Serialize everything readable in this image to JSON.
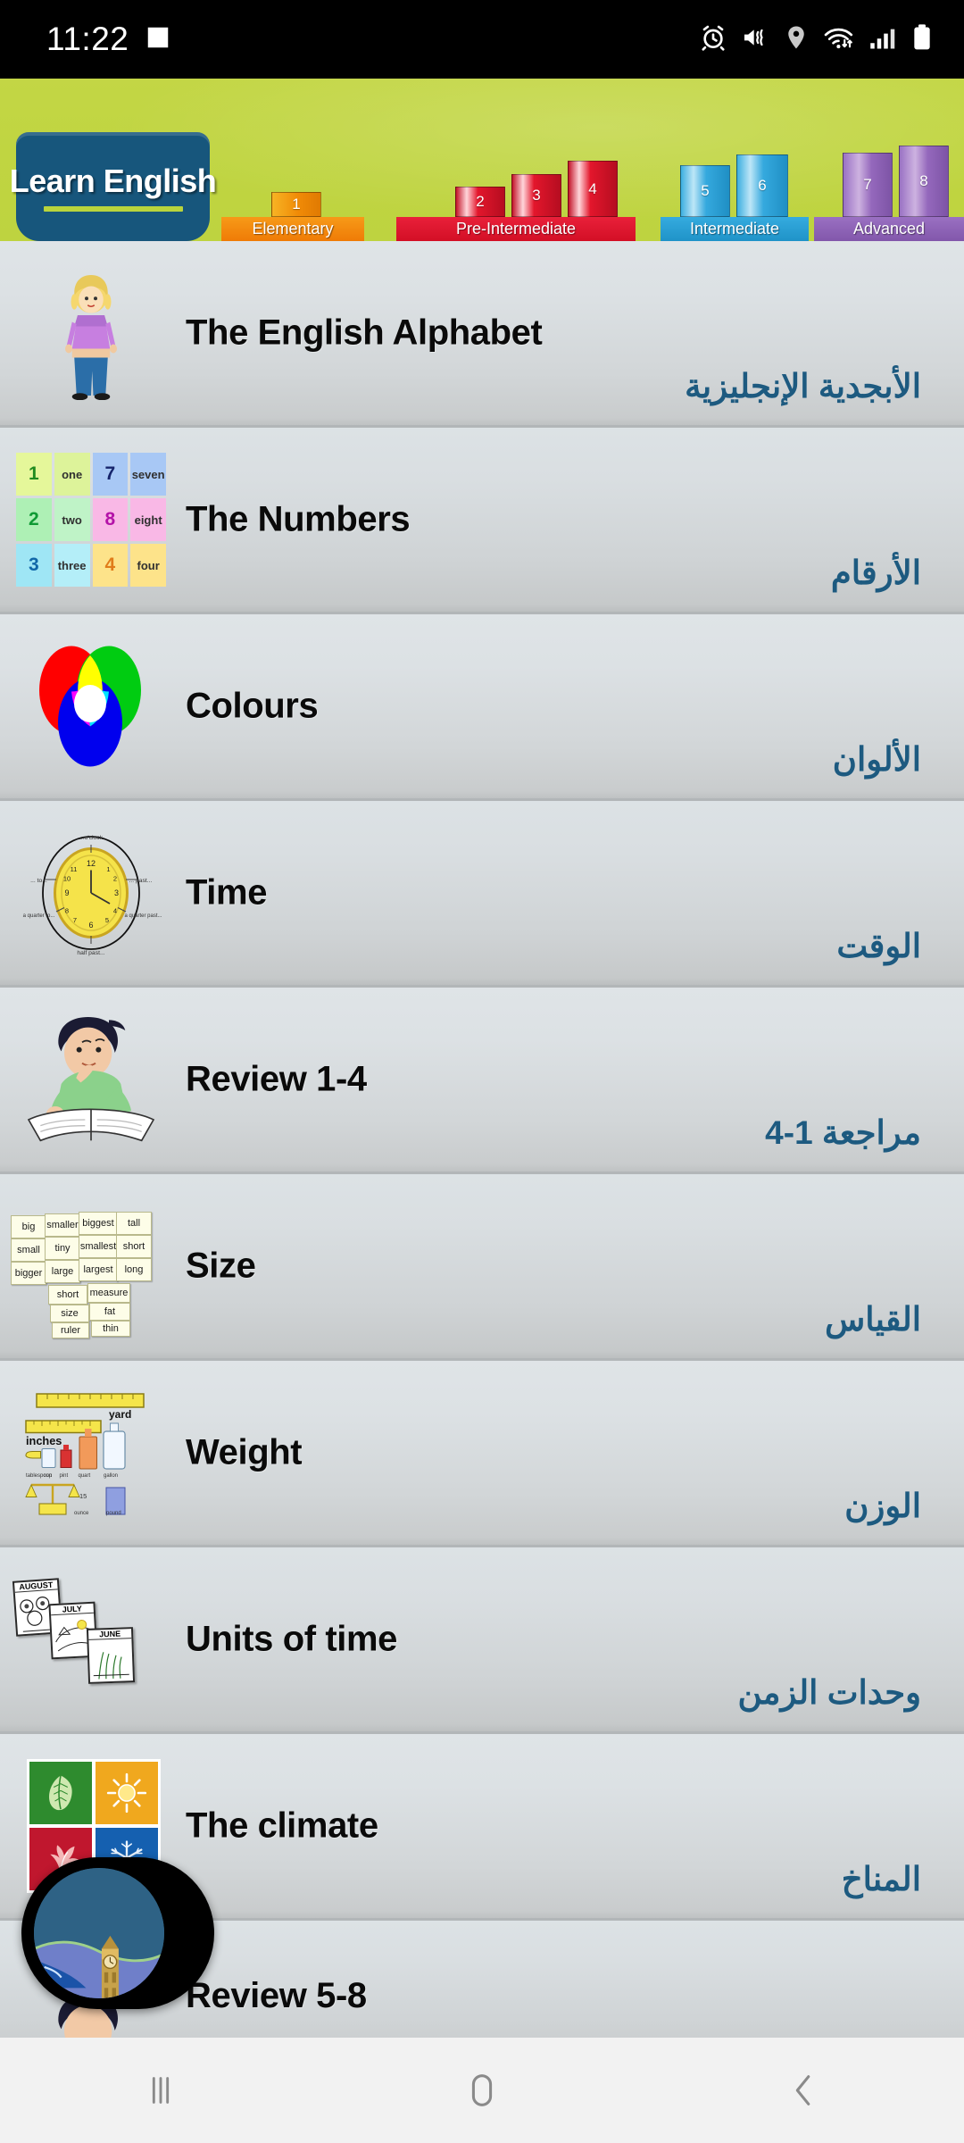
{
  "status_bar": {
    "time": "11:22",
    "left_icons": [
      {
        "name": "screenshot-image-icon",
        "label": "image"
      }
    ],
    "right_icons": [
      {
        "name": "alarm-icon",
        "label": "alarm"
      },
      {
        "name": "mute-vibrate-icon",
        "label": "sound off"
      },
      {
        "name": "location-icon",
        "label": "location"
      },
      {
        "name": "wifi-icon",
        "label": "wifi"
      },
      {
        "name": "signal-icon",
        "label": "signal"
      },
      {
        "name": "battery-icon",
        "label": "battery"
      }
    ]
  },
  "banner": {
    "logo_text": "Learn English",
    "levels": [
      {
        "name": "Elementary",
        "units": [
          "1"
        ],
        "color": "#f28c14",
        "label_color": "#f07d09"
      },
      {
        "name": "Pre-Intermediate",
        "units": [
          "2",
          "3",
          "4"
        ],
        "color": "#e3162c",
        "label_color": "#e3162c"
      },
      {
        "name": "Intermediate",
        "units": [
          "5",
          "6"
        ],
        "color": "#2eaede",
        "label_color": "#28a8dc"
      },
      {
        "name": "Advanced",
        "units": [
          "7",
          "8"
        ],
        "color": "#9268bd",
        "label_color": "#8e63b9"
      }
    ]
  },
  "lessons": [
    {
      "title": "The English Alphabet",
      "title_ar": "الأبجدية الإنجليزية",
      "thumb": "girl-standing-icon"
    },
    {
      "title": "The Numbers",
      "title_ar": "الأرقام",
      "thumb": "numbers-grid-icon",
      "thumb_cells": [
        "1",
        "one",
        "7",
        "seven",
        "2",
        "two",
        "8",
        "eight",
        "3",
        "three",
        "4",
        "four"
      ]
    },
    {
      "title": "Colours",
      "title_ar": "الألوان",
      "thumb": "colour-venn-icon"
    },
    {
      "title": "Time",
      "title_ar": "الوقت",
      "thumb": "clock-icon"
    },
    {
      "title": "Review 1-4",
      "title_ar": "مراجعة 1-4",
      "thumb": "boy-reading-icon"
    },
    {
      "title": "Size",
      "title_ar": "القياس",
      "thumb": "size-word-cards-icon",
      "thumb_cells": [
        "big",
        "smaller",
        "biggest",
        "tall",
        "small",
        "tiny",
        "smallest",
        "short",
        "bigger",
        "large",
        "largest",
        "long",
        "short",
        "measure",
        "size",
        "fat",
        "ruler",
        "thin"
      ]
    },
    {
      "title": "Weight",
      "title_ar": "الوزن",
      "thumb": "weight-measures-icon",
      "thumb_cells": [
        "yard",
        "inches",
        "tablespoon",
        "cup",
        "pint",
        "quart",
        "gallon",
        "ounce",
        "pound"
      ]
    },
    {
      "title": "Units of time",
      "title_ar": "وحدات الزمن",
      "thumb": "calendar-pages-icon",
      "thumb_cells": [
        "AUGUST",
        "JULY",
        "JUNE"
      ]
    },
    {
      "title": "The climate",
      "title_ar": "المناخ",
      "thumb": "climate-seasons-icon"
    },
    {
      "title": "Review 5-8",
      "title_ar": "",
      "thumb": "boy-reading-icon"
    }
  ],
  "floating_bubble": {
    "name": "floating-overlay-bubble",
    "image_label": "big-ben-landscape"
  },
  "nav_bar": {
    "buttons": [
      {
        "name": "recents-button",
        "label": "Recents"
      },
      {
        "name": "home-button",
        "label": "Home"
      },
      {
        "name": "back-button",
        "label": "Back"
      }
    ]
  }
}
